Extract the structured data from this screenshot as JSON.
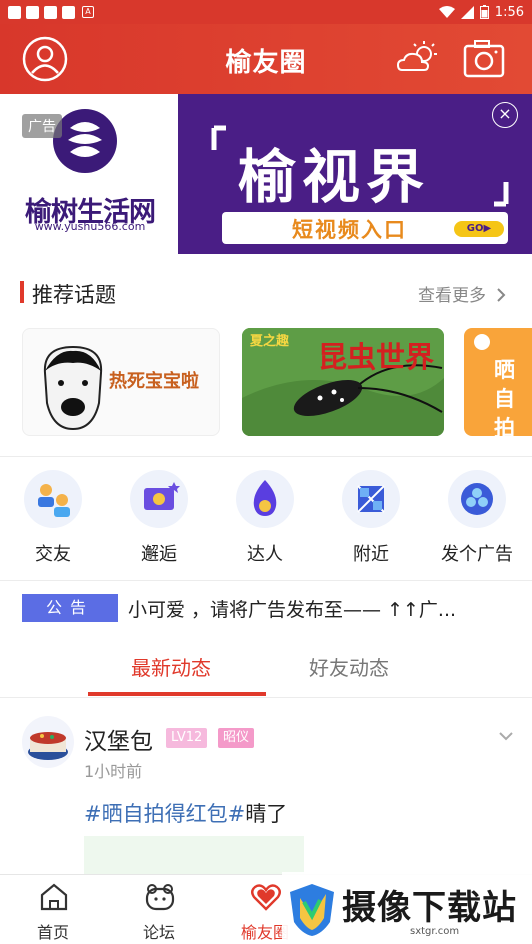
{
  "status_bar": {
    "time": "1:56"
  },
  "header": {
    "title": "榆友圈"
  },
  "banner": {
    "ad_tag": "广告",
    "logo_text": "榆树生活网",
    "logo_url": "www.yushu566.com",
    "big_title": "榆视界",
    "sub_text": "短视频入口",
    "go_label": "GO▶",
    "close_glyph": "×"
  },
  "recommended": {
    "title": "推荐话题",
    "more": "查看更多",
    "topics": [
      {
        "caption": "热死宝宝啦"
      },
      {
        "caption": "昆虫世界",
        "corner": "夏之趣"
      },
      {
        "caption": "晒自拍得"
      }
    ]
  },
  "grid": [
    {
      "label": "交友",
      "icon": "friends-icon"
    },
    {
      "label": "邂逅",
      "icon": "encounter-icon"
    },
    {
      "label": "达人",
      "icon": "expert-icon"
    },
    {
      "label": "附近",
      "icon": "nearby-icon"
    },
    {
      "label": "发个广告",
      "icon": "post-ad-icon"
    }
  ],
  "notice": {
    "tag": "公告",
    "text": "小可爱 ，请将广告发布至—— ↑↑广..."
  },
  "tabs": {
    "latest": "最新动态",
    "friends": "好友动态"
  },
  "post": {
    "name": "汉堡包",
    "level": "LV12",
    "title_badge": "昭仪",
    "time": "1小时前",
    "hashtag": "#晒自拍得红包#",
    "text": "晴了"
  },
  "bottom_nav": [
    {
      "label": "首页",
      "icon": "home-icon"
    },
    {
      "label": "论坛",
      "icon": "forum-icon"
    },
    {
      "label": "榆友圈",
      "icon": "heart-icon"
    }
  ],
  "watermark": {
    "text": "摄像下载站",
    "url": "sxtgr.com"
  },
  "colors": {
    "brand_red": "#d8382c",
    "accent_blue": "#5b6de4",
    "hashtag_blue": "#3e6fb5"
  }
}
